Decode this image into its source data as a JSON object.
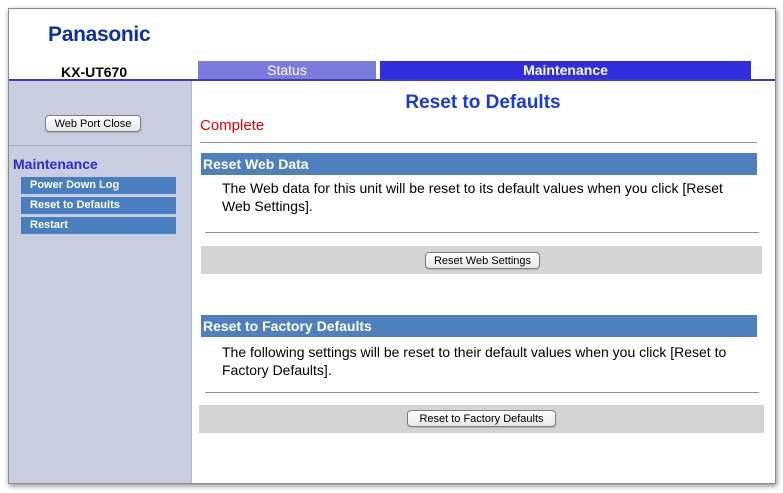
{
  "header": {
    "brand": "Panasonic",
    "model": "KX-UT670",
    "tabs": [
      {
        "label": "Status",
        "active": false
      },
      {
        "label": "Maintenance",
        "active": true
      }
    ]
  },
  "sidebar": {
    "web_port_close_label": "Web Port Close",
    "section_heading": "Maintenance",
    "items": [
      {
        "label": "Power Down Log"
      },
      {
        "label": "Reset to Defaults"
      },
      {
        "label": "Restart"
      }
    ]
  },
  "main": {
    "title": "Reset to Defaults",
    "status": "Complete",
    "reset_web": {
      "heading": "Reset Web Data",
      "description": "The Web data for this unit will be reset to its default values when you click [Reset Web Settings].",
      "button_label": "Reset Web Settings"
    },
    "reset_factory": {
      "heading": "Reset to Factory Defaults",
      "description": "The following settings will be reset to their default values when you click [Reset to Factory Defaults].",
      "button_label": "Reset to Factory Defaults"
    }
  },
  "colors": {
    "brand": "#0a2fa8",
    "tab_status": "#7b7bdc",
    "tab_active": "#2f2fe0",
    "sidebar_bg": "#c8cde0",
    "section_bar": "#4f80be",
    "status_text": "#e00000"
  }
}
